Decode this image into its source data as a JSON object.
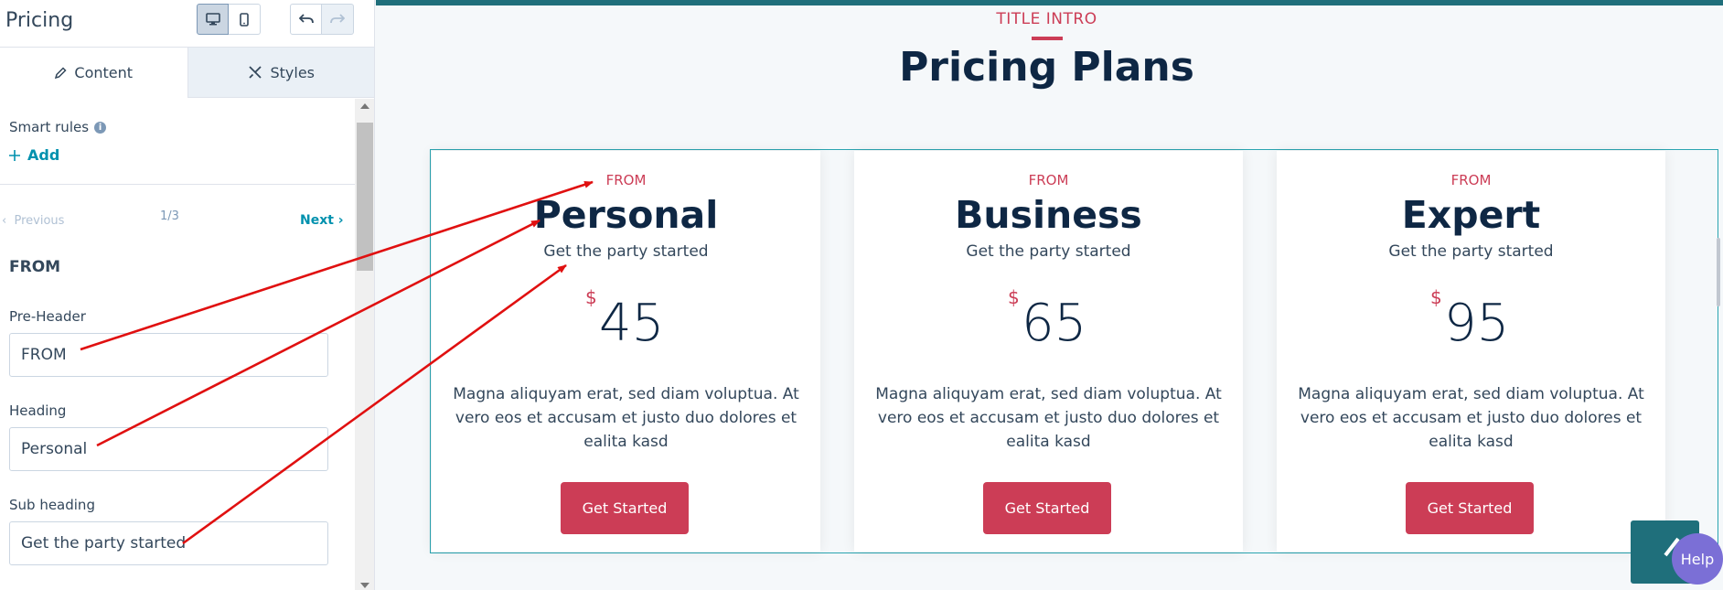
{
  "panel": {
    "title": "Pricing",
    "tabs": [
      {
        "label": "Content",
        "icon": "pencil-icon"
      },
      {
        "label": "Styles",
        "icon": "styles-icon"
      }
    ],
    "smart_rules_label": "Smart rules",
    "add_label": "Add",
    "pager": {
      "prev": "Previous",
      "count": "1/3",
      "next": "Next"
    },
    "section_title": "FROM",
    "fields": [
      {
        "label": "Pre-Header",
        "value": "FROM"
      },
      {
        "label": "Heading",
        "value": "Personal"
      },
      {
        "label": "Sub heading",
        "value": "Get the party started"
      }
    ]
  },
  "preview": {
    "intro": "TITLE INTRO",
    "title": "Pricing Plans",
    "cards": [
      {
        "from": "FROM",
        "name": "Personal",
        "sub": "Get the party started",
        "currency": "$",
        "amount": "45",
        "desc": "Magna aliquyam erat, sed diam voluptua. At vero eos et accusam et justo duo dolores et ealita kasd",
        "cta": "Get Started"
      },
      {
        "from": "FROM",
        "name": "Business",
        "sub": "Get the party started",
        "currency": "$",
        "amount": "65",
        "desc": "Magna aliquyam erat, sed diam voluptua. At vero eos et accusam et justo duo dolores et ealita kasd",
        "cta": "Get Started"
      },
      {
        "from": "FROM",
        "name": "Expert",
        "sub": "Get the party started",
        "currency": "$",
        "amount": "95",
        "desc": "Magna aliquyam erat, sed diam voluptua. At vero eos et accusam et justo duo dolores et ealita kasd",
        "cta": "Get Started"
      }
    ],
    "help_label": "Help"
  },
  "colors": {
    "accent": "#cc3d56",
    "heading": "#0e2744",
    "link": "#0091ae",
    "teal": "#1f6f7b",
    "arrow": "#e01010"
  }
}
